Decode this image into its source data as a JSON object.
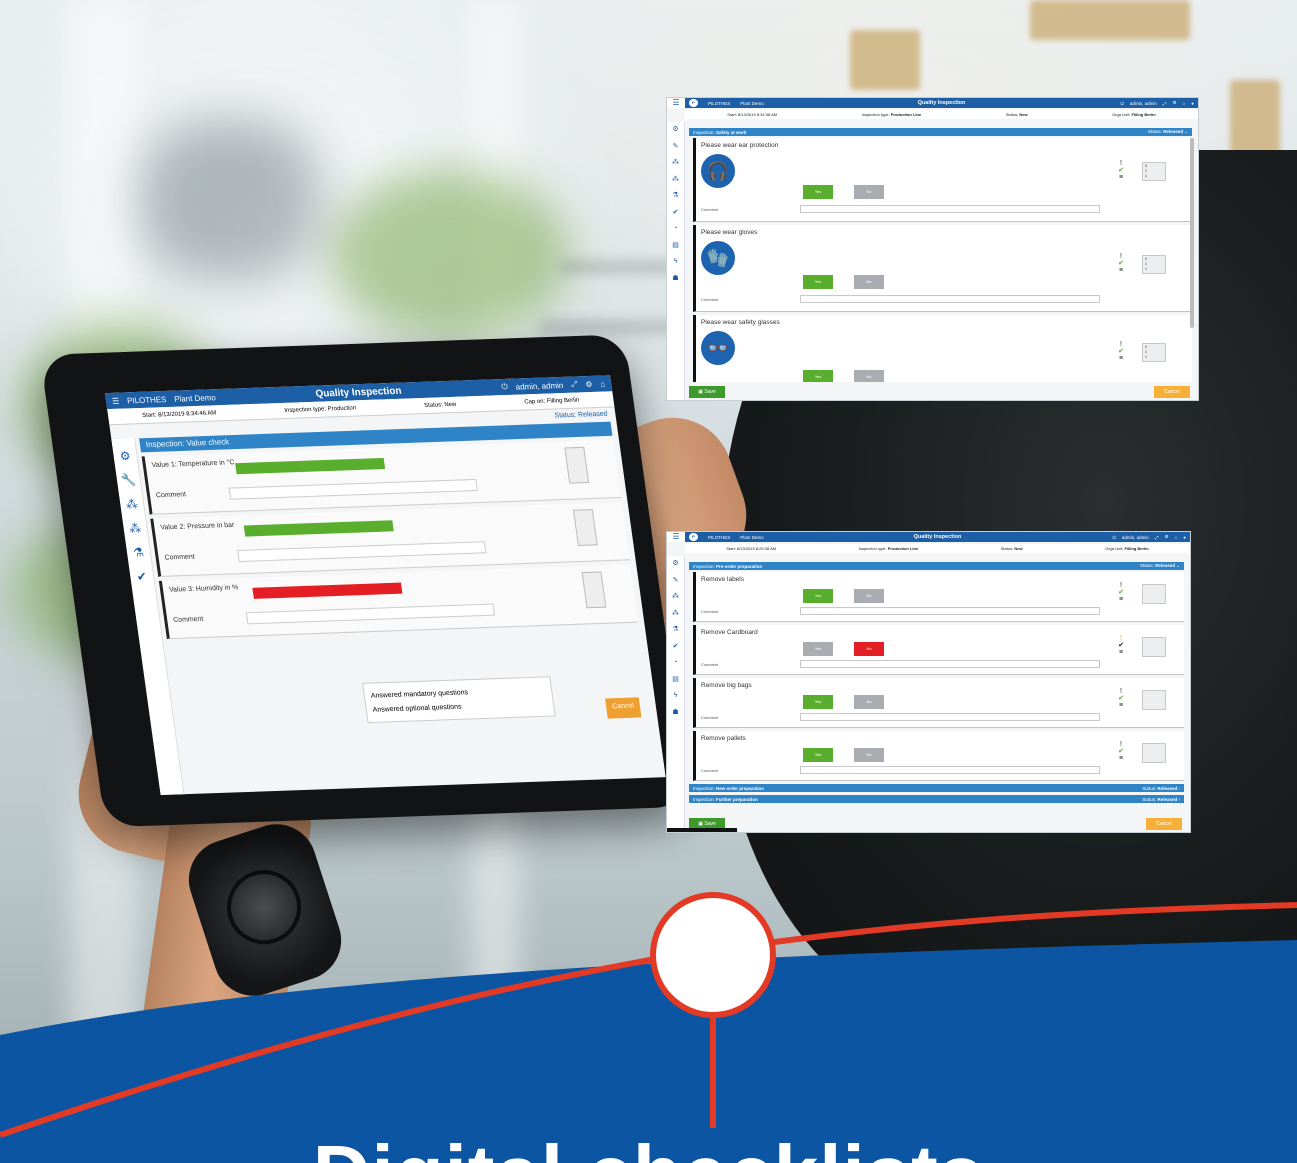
{
  "colors": {
    "brand_blue": "#1d5fa6",
    "section_blue": "#2f83c7",
    "yes_green": "#5aae2e",
    "no_red": "#e31e24",
    "neutral_grey": "#a9adb1",
    "save_green": "#3e9a2c",
    "cancel_orange": "#f7b037",
    "wave_blue": "#0c55a3",
    "accent_red": "#e23a25"
  },
  "tablet": {
    "app_name": "PILOTHES",
    "demo": "Plant Demo",
    "title": "Quality Inspection",
    "user": "admin, admin",
    "meta": [
      "Start: 8/13/2019 8:34:46 AM",
      "Inspection type: Production",
      "Status: New",
      "Cap on: Filling Berlin"
    ],
    "status": "Status: Released",
    "inspection": "Inspection: Value check",
    "rows": [
      {
        "label": "Value 1: Temperature in °C",
        "comment": "Comment",
        "bar_color": "#5aae2e"
      },
      {
        "label": "Value 2: Pressure in bar",
        "comment": "Comment",
        "bar_color": "#5aae2e"
      },
      {
        "label": "Value 3: Humidity in %",
        "comment": "Comment",
        "bar_color": "#e31e24"
      }
    ],
    "answers": [
      "Answered mandatory questions",
      "Answered optional questions"
    ],
    "cancel": "Cancel"
  },
  "app1": {
    "logo": "P",
    "app_name": "PILOTHES",
    "demo": "Plant Demo",
    "title": "Quality Inspection",
    "user": "admin, admin",
    "menu_icon": "hamburger-icon",
    "meta": {
      "start": "Start: 8/13/2019 8:34:38 AM",
      "type_label": "Inspection type:",
      "type_value": "Production Line",
      "status_label": "Status:",
      "status_value": "New",
      "org_label": "Orga Unit:",
      "org_value": "Filling Berlin"
    },
    "inspection": {
      "label": "Inspection:",
      "name": "Safety at work",
      "status_label": "Status:",
      "status_value": "Released"
    },
    "questions": [
      {
        "label": "Please wear ear protection",
        "yes": "Yes",
        "no": "No",
        "comment": "Comment",
        "icon": "ear-protection-icon",
        "glyph": "🎧"
      },
      {
        "label": "Please wear gloves",
        "yes": "Yes",
        "no": "No",
        "comment": "Comment",
        "icon": "gloves-icon",
        "glyph": "🧤"
      },
      {
        "label": "Please wear safety glasses",
        "yes": "Yes",
        "no": "No",
        "comment": "Comment",
        "icon": "safety-glasses-icon",
        "glyph": "👓"
      }
    ],
    "counter_values": [
      "0",
      "1",
      "1"
    ],
    "save": "Save",
    "cancel": "Cancel"
  },
  "app2": {
    "logo": "P",
    "app_name": "PILOTHES",
    "demo": "Plant Demo",
    "title": "Quality Inspection",
    "user": "admin, admin",
    "meta": {
      "start": "Start: 8/13/2019 8:25:38 AM",
      "type_label": "Inspection type:",
      "type_value": "Production Line",
      "status_label": "Status:",
      "status_value": "New",
      "org_label": "Orga Unit:",
      "org_value": "Filling Berlin"
    },
    "inspection": {
      "label": "Inspection:",
      "name": "Pre-order preparation",
      "status_label": "Status:",
      "status_value": "Released"
    },
    "questions": [
      {
        "label": "Remove labels",
        "yes": "Yes",
        "no": "No",
        "comment": "Comment",
        "answer": "yes"
      },
      {
        "label": "Remove Cardboard",
        "yes": "Yes",
        "no": "No",
        "comment": "Comment",
        "answer": "no"
      },
      {
        "label": "Remove big bags",
        "yes": "Yes",
        "no": "No",
        "comment": "Comment",
        "answer": "yes"
      },
      {
        "label": "Remove pallets",
        "yes": "Yes",
        "no": "No",
        "comment": "Comment",
        "answer": "yes"
      }
    ],
    "collapsed": [
      {
        "label": "Inspection:",
        "name": "New order preparation",
        "status_label": "Status:",
        "status_value": "Released"
      },
      {
        "label": "Inspection:",
        "name": "Further preparation",
        "status_label": "Status:",
        "status_value": "Released"
      }
    ],
    "save": "Save",
    "cancel": "Cancel"
  },
  "headline": "Digital checklists"
}
